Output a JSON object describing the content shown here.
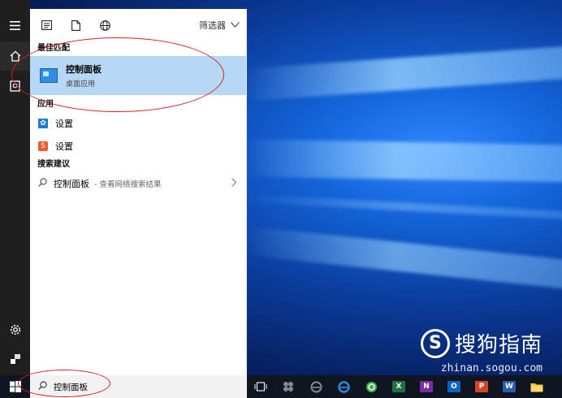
{
  "start_menu": {
    "toolbar": {
      "filter_label": "筛选器",
      "icons": [
        "document-list-icon",
        "file-icon",
        "globe-icon"
      ]
    },
    "best_match": {
      "section_title": "最佳匹配",
      "title": "控制面板",
      "subtitle": "桌面应用",
      "icon": "control-panel-icon",
      "highlight_color": "#b7d8f4"
    },
    "apps": {
      "section_title": "应用",
      "items": [
        {
          "label": "设置",
          "icon": "gear-icon",
          "icon_color": "#1e7bd6"
        },
        {
          "label": "设置",
          "icon": "sogou-icon",
          "icon_color": "#ea5a2a"
        }
      ]
    },
    "suggestions": {
      "section_title": "搜索建议",
      "items": [
        {
          "label": "控制面板",
          "hint": "- 查看网络搜索结果"
        }
      ]
    },
    "rail_icons": [
      "hamburger-icon",
      "home-icon",
      "recent-icon",
      "settings-icon",
      "user-icon"
    ]
  },
  "taskbar": {
    "search_value": "控制面板",
    "pinned_icons": [
      "task-view-icon",
      "app-icon",
      "edge-icon",
      "edge-icon",
      "360-icon",
      "excel-icon",
      "onenote-icon",
      "outlook-icon",
      "powerpoint-icon",
      "word-icon",
      "file-explorer-icon"
    ]
  },
  "watermark": {
    "logo_letter": "S",
    "text": "搜狗指南",
    "url": "zhinan.sogou.com"
  },
  "colors": {
    "accent_red": "#d62020",
    "taskbar_bg": "#101522"
  }
}
